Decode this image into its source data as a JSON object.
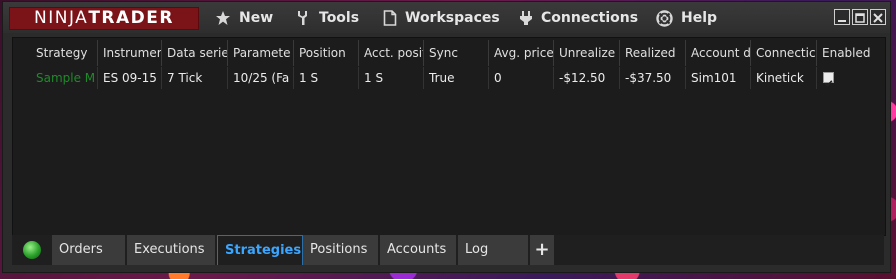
{
  "app": {
    "logo_ninja": "NINJA",
    "logo_trader": "TRADER"
  },
  "menu": {
    "new": "New",
    "tools": "Tools",
    "workspaces": "Workspaces",
    "connections": "Connections",
    "help": "Help"
  },
  "grid": {
    "columns": [
      "Strategy",
      "Instrumer",
      "Data serie",
      "Paramete",
      "Position",
      "Acct. posit",
      "Sync",
      "Avg. price",
      "Unrealize",
      "Realized",
      "Account d",
      "Connectic",
      "Enabled"
    ],
    "rows": [
      {
        "strategy": "Sample M",
        "instrument": "ES 09-15",
        "data_series": "7 Tick",
        "parameters": "10/25 (Fa",
        "position": "1 S",
        "acct_position": "1 S",
        "sync": "True",
        "avg_price": "0",
        "unrealized": "-$12.50",
        "realized": "-$37.50",
        "account": "Sim101",
        "connection": "Kinetick",
        "enabled": true
      }
    ]
  },
  "tabs": {
    "orders": "Orders",
    "executions": "Executions",
    "strategies": "Strategies",
    "positions": "Positions",
    "accounts": "Accounts",
    "log": "Log",
    "add": "+"
  },
  "colors": {
    "logo_bg": "#7a1418",
    "active_tab": "#3aa6ff",
    "strategy_text": "#1f8a2a",
    "connection_ok": "#2aa02a"
  },
  "icons": {
    "new": "star-icon",
    "tools": "wrench-icon",
    "workspaces": "document-icon",
    "connections": "plug-icon",
    "help": "lifebuoy-icon"
  }
}
